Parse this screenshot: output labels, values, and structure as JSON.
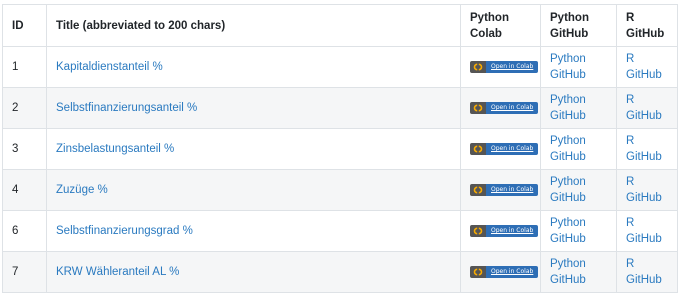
{
  "table": {
    "headers": {
      "id": "ID",
      "title": "Title (abbreviated to 200 chars)",
      "python_colab_line1": "Python",
      "python_colab_line2": "Colab",
      "python_github_line1": "Python",
      "python_github_line2": "GitHub",
      "r_github_line1": "R",
      "r_github_line2": "GitHub"
    },
    "rows": [
      {
        "id": "1",
        "title": "Kapitaldienstanteil %",
        "colab_badge": "Open in Colab",
        "python_link_1": "Python",
        "python_link_2": "GitHub",
        "r_link_1": "R",
        "r_link_2": "GitHub"
      },
      {
        "id": "2",
        "title": "Selbstfinanzierungsanteil %",
        "colab_badge": "Open in Colab",
        "python_link_1": "Python",
        "python_link_2": "GitHub",
        "r_link_1": "R",
        "r_link_2": "GitHub"
      },
      {
        "id": "3",
        "title": "Zinsbelastungsanteil %",
        "colab_badge": "Open in Colab",
        "python_link_1": "Python",
        "python_link_2": "GitHub",
        "r_link_1": "R",
        "r_link_2": "GitHub"
      },
      {
        "id": "4",
        "title": "Zuzüge %",
        "colab_badge": "Open in Colab",
        "python_link_1": "Python",
        "python_link_2": "GitHub",
        "r_link_1": "R",
        "r_link_2": "GitHub"
      },
      {
        "id": "6",
        "title": "Selbstfinanzierungsgrad %",
        "colab_badge": "Open in Colab",
        "python_link_1": "Python",
        "python_link_2": "GitHub",
        "r_link_1": "R",
        "r_link_2": "GitHub"
      },
      {
        "id": "7",
        "title": "KRW Wähleranteil AL %",
        "colab_badge": "Open in Colab",
        "python_link_1": "Python",
        "python_link_2": "GitHub",
        "r_link_1": "R",
        "r_link_2": "GitHub"
      }
    ]
  },
  "colors": {
    "link": "#2a7ac0",
    "badge_left": "#555555",
    "badge_right": "#2e6eb5",
    "colab_logo_orange": "#f9ab00",
    "stripe": "#f5f6f7",
    "border": "#dee2e6"
  },
  "icons": {
    "colab_logo": "colab-logo-icon"
  }
}
